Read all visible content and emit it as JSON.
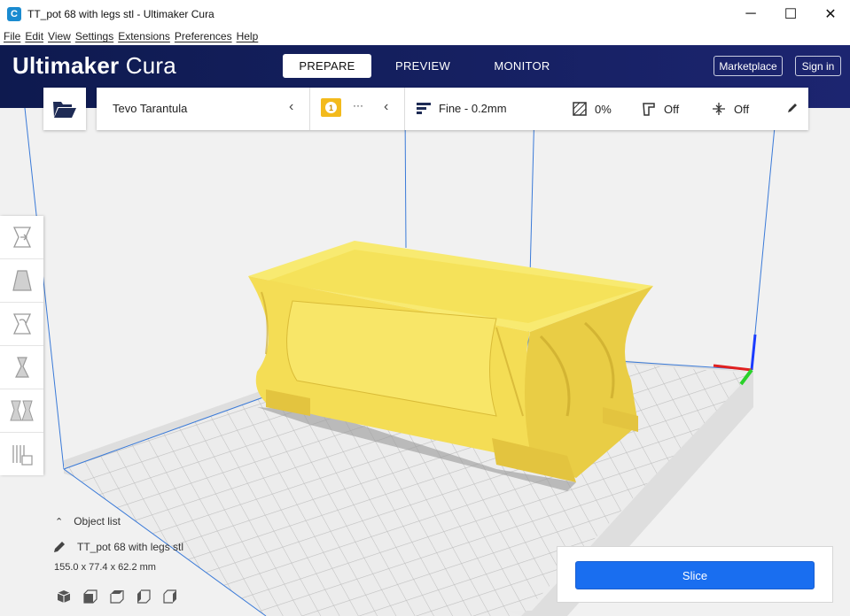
{
  "window": {
    "title": "TT_pot 68 with legs stl - Ultimaker Cura",
    "app_icon": "cura-app-icon",
    "controls": {
      "minimize": "─",
      "maximize": "☐",
      "close": "✕"
    }
  },
  "menu": [
    "File",
    "Edit",
    "View",
    "Settings",
    "Extensions",
    "Preferences",
    "Help"
  ],
  "header": {
    "logo_bold": "Ultimaker",
    "logo_light": " Cura",
    "stages": [
      "PREPARE",
      "PREVIEW",
      "MONITOR"
    ],
    "active_stage": "PREPARE",
    "marketplace_label": "Marketplace",
    "signin_label": "Sign in",
    "colors": {
      "header_bg": "#10195a",
      "accent": "#196ef0"
    }
  },
  "print_setup": {
    "printer": "Tevo Tarantula",
    "extruder_badge": "1",
    "extruder_material": "···",
    "profile": "Fine - 0.2mm",
    "infill": "0%",
    "support": "Off",
    "adhesion": "Off"
  },
  "left_tools": [
    "move-tool",
    "scale-tool",
    "rotate-tool",
    "mirror-tool",
    "per-model-settings-tool",
    "support-blocker-tool"
  ],
  "object_list": {
    "toggle_label": "Object list",
    "object_name": "TT_pot 68 with legs stl",
    "dimensions": "155.0 x 77.4 x 62.2 mm"
  },
  "view_orientations": [
    "3d-view-icon",
    "front-view-icon",
    "top-view-icon",
    "left-view-icon",
    "right-view-icon"
  ],
  "slice": {
    "button_label": "Slice"
  },
  "model_color": "#f8e668"
}
